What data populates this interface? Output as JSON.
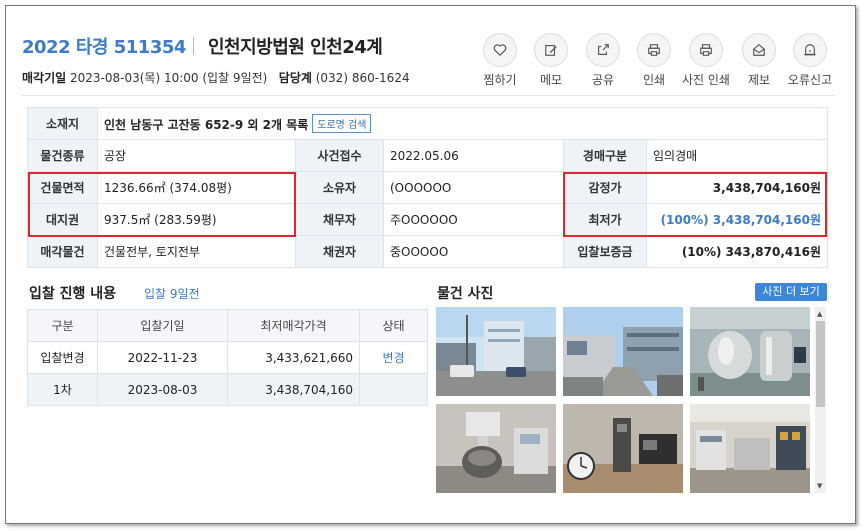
{
  "header": {
    "case_number": "2022 타경 511354",
    "court": "인천지방법원 인천24계",
    "sale_date_label": "매각기일",
    "sale_date_value": "2023-08-03(목) 10:00 (입찰 9일전)",
    "contact_label": "담당계",
    "contact_value": "(032) 860-1624"
  },
  "actions": [
    {
      "label": "찜하기",
      "icon": "heart-icon"
    },
    {
      "label": "메모",
      "icon": "memo-icon"
    },
    {
      "label": "공유",
      "icon": "share-icon"
    },
    {
      "label": "인쇄",
      "icon": "print-icon"
    },
    {
      "label": "사진 인쇄",
      "icon": "print-photo-icon"
    },
    {
      "label": "제보",
      "icon": "report-icon"
    },
    {
      "label": "오류신고",
      "icon": "error-report-icon"
    }
  ],
  "info": {
    "location_label": "소재지",
    "location_value": "인천 남동구 고잔동 652-9 외 2개 목록",
    "road_button": "도로명 검색",
    "type_label": "물건종류",
    "type_value": "공장",
    "received_label": "사건접수",
    "received_value": "2022.05.06",
    "auction_type_label": "경매구분",
    "auction_type_value": "임의경매",
    "building_area_label": "건물면적",
    "building_area_value": "1236.66㎡ (374.08평)",
    "owner_label": "소유자",
    "owner_value": "(OOOOOO",
    "appraisal_label": "감정가",
    "appraisal_value": "3,438,704,160원",
    "land_right_label": "대지권",
    "land_right_value": "937.5㎡ (283.59평)",
    "debtor_label": "채무자",
    "debtor_value": "주OOOOOO",
    "min_price_label": "최저가",
    "min_price_value": "(100%) 3,438,704,160원",
    "sale_item_label": "매각물건",
    "sale_item_value": "건물전부, 토지전부",
    "creditor_label": "채권자",
    "creditor_value": "중OOOOO",
    "deposit_label": "입찰보증금",
    "deposit_value": "(10%) 343,870,416원"
  },
  "bidding": {
    "title": "입찰 진행 내용",
    "subtitle": "입찰 9일전",
    "columns": [
      "구분",
      "입찰기일",
      "최저매각가격",
      "상태"
    ],
    "rows": [
      {
        "type": "입찰변경",
        "date": "2022-11-23",
        "price": "3,433,621,660",
        "status": "변경"
      },
      {
        "type": "1차",
        "date": "2023-08-03",
        "price": "3,438,704,160",
        "status": ""
      }
    ]
  },
  "photos": {
    "title": "물건 사진",
    "more_button": "사진 더 보기"
  },
  "colors": {
    "accent": "#3d7ac8",
    "highlight_box": "#e0262a",
    "header_cell": "#eef3f8"
  }
}
